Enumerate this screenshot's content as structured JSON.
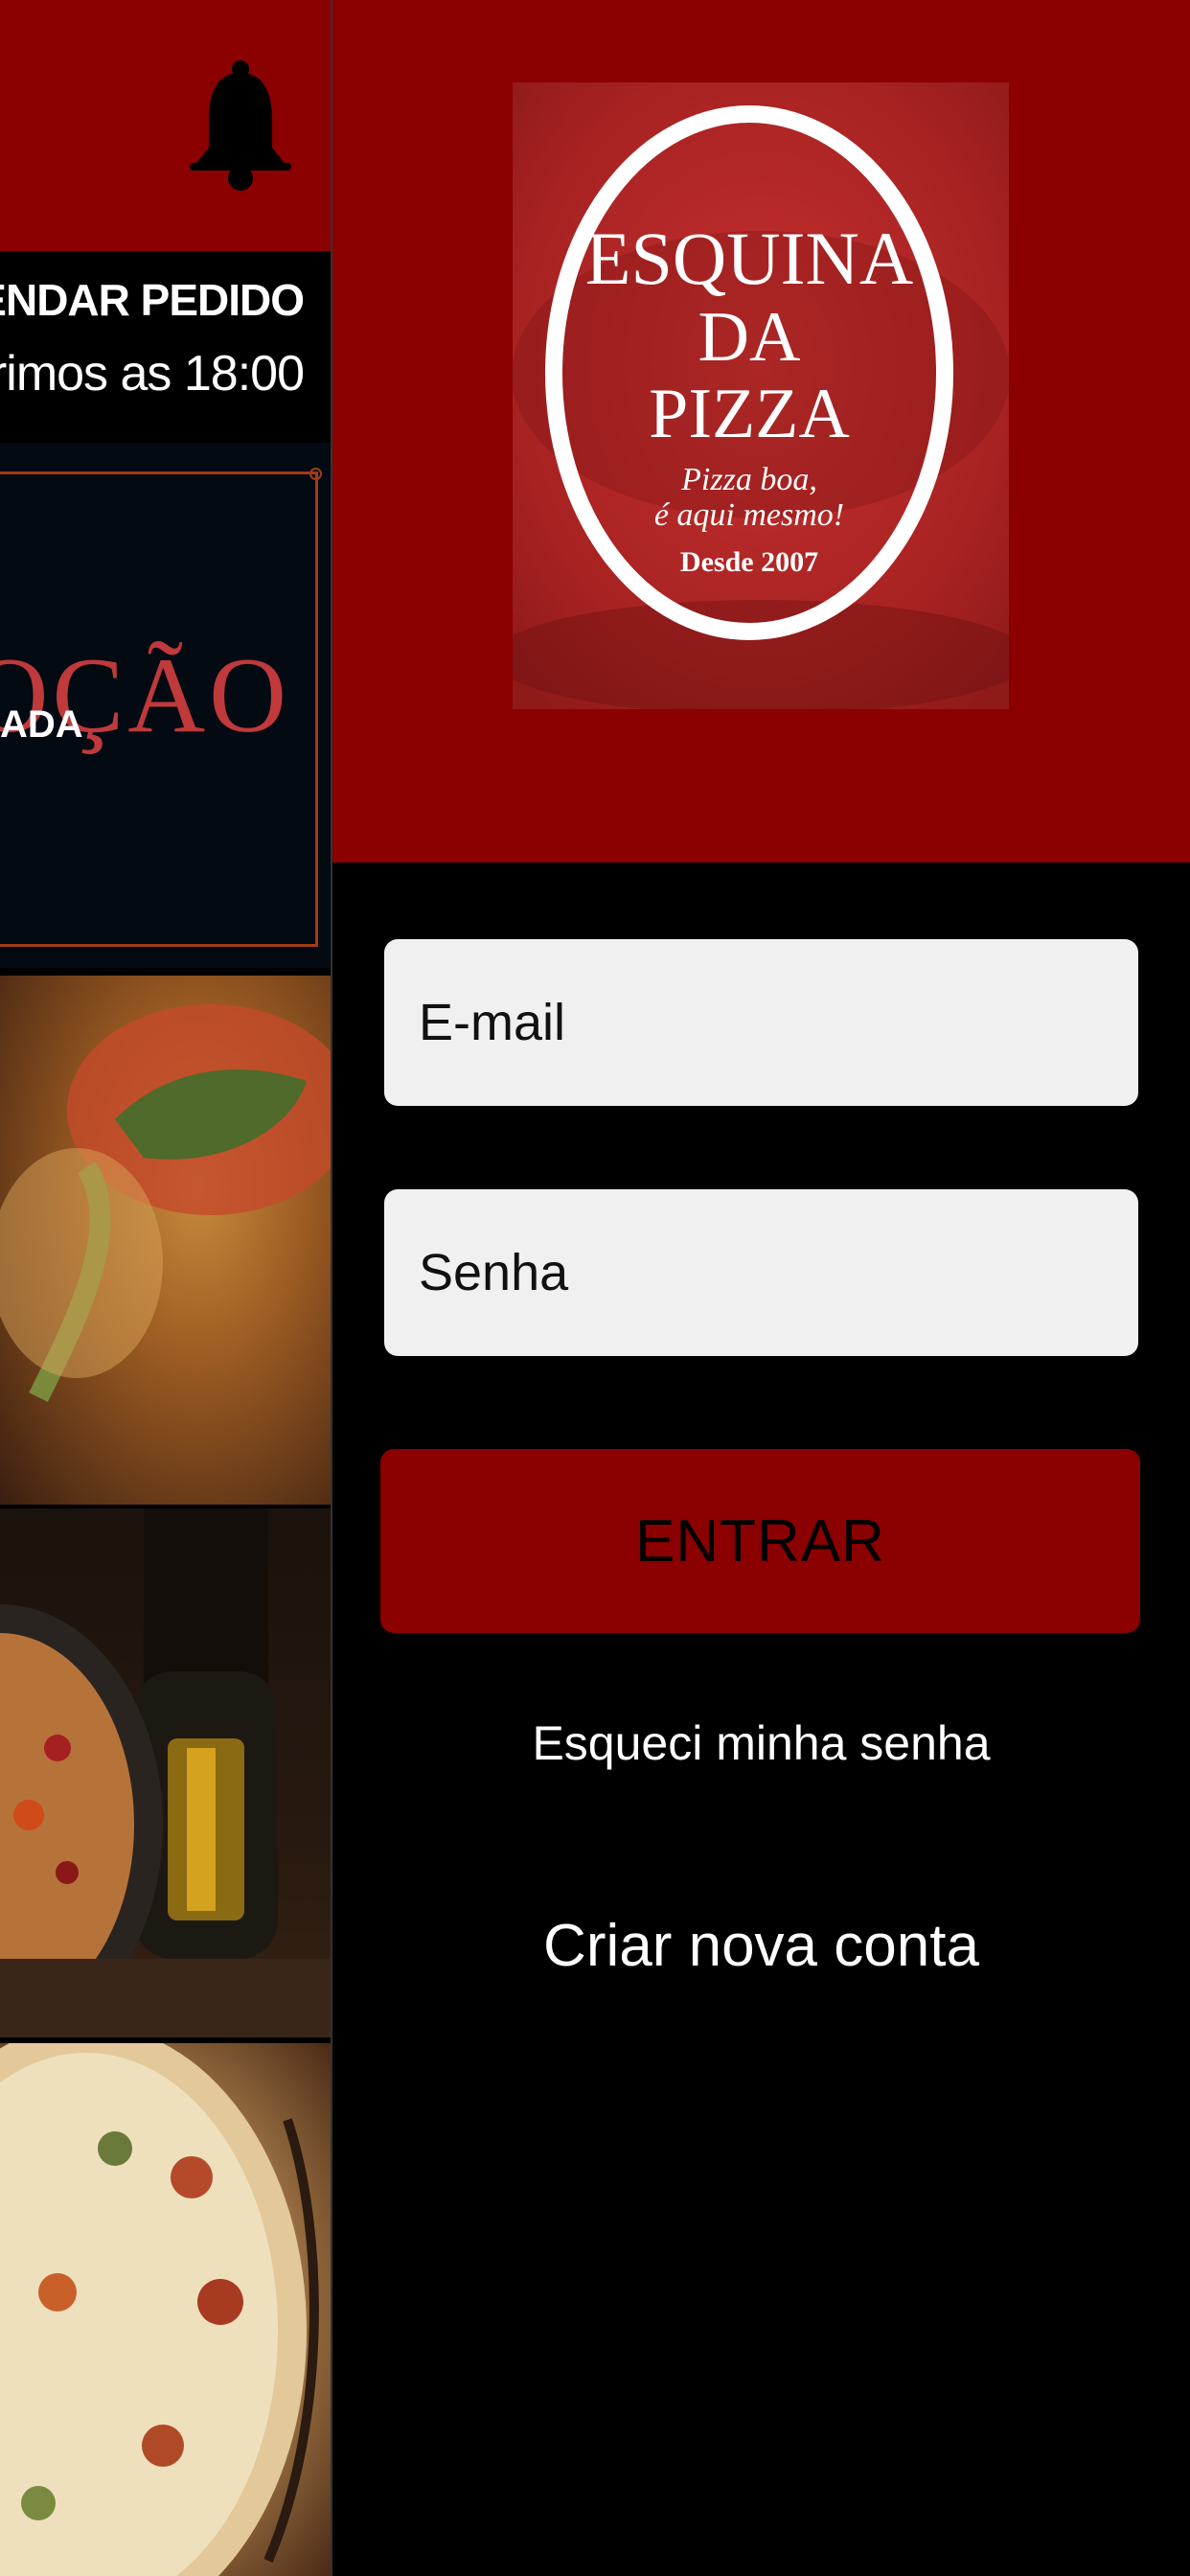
{
  "background_screen": {
    "schedule": {
      "title": "GENDAR PEDIDO",
      "subtitle": "rimos as 18:00"
    },
    "promo": {
      "word": "MOÇÃO",
      "subtitle": "ADA"
    },
    "icons": {
      "notification": "bell-icon"
    }
  },
  "login": {
    "logo": {
      "line1": "ESQUINA",
      "line2": "DA",
      "line3": "PIZZA",
      "slogan_line1": "Pizza boa,",
      "slogan_line2": "é aqui mesmo!",
      "since": "Desde 2007"
    },
    "email_placeholder": "E-mail",
    "password_placeholder": "Senha",
    "submit_label": "ENTRAR",
    "forgot_password_label": "Esqueci minha senha",
    "create_account_label": "Criar nova conta"
  },
  "colors": {
    "brand_red": "#8b0000",
    "field_background": "#f0f0f0",
    "background": "#000000"
  }
}
